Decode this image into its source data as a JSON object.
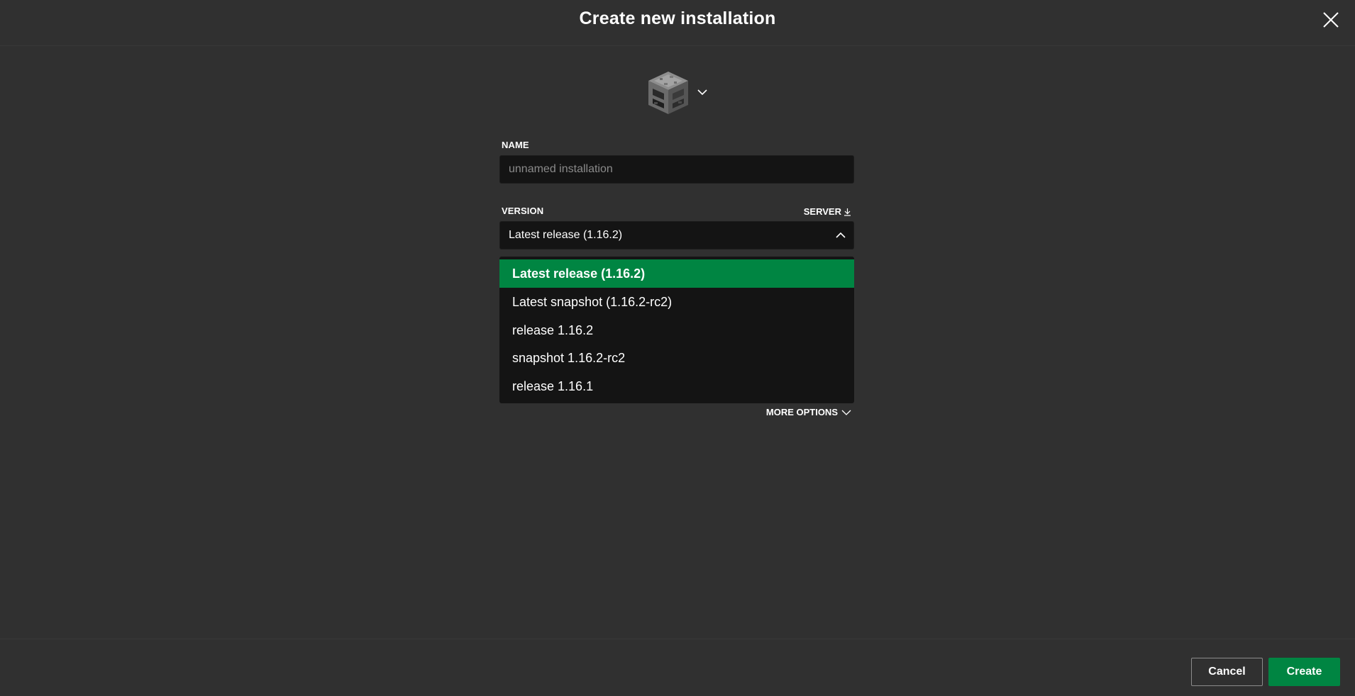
{
  "dialog": {
    "title": "Create new installation"
  },
  "icon": {
    "selected": "furnace-block-icon"
  },
  "name_field": {
    "label": "NAME",
    "placeholder": "unnamed installation",
    "value": ""
  },
  "version_field": {
    "label": "VERSION",
    "server_label": "SERVER",
    "selected": "Latest release (1.16.2)",
    "dropdown_open": true,
    "options": [
      "Latest release (1.16.2)",
      "Latest snapshot (1.16.2-rc2)",
      "release 1.16.2",
      "snapshot 1.16.2-rc2",
      "release 1.16.1"
    ]
  },
  "more_options_label": "MORE OPTIONS",
  "footer": {
    "cancel_label": "Cancel",
    "create_label": "Create"
  },
  "colors": {
    "background": "#303030",
    "input_background": "#141414",
    "accent_green": "#008542"
  }
}
